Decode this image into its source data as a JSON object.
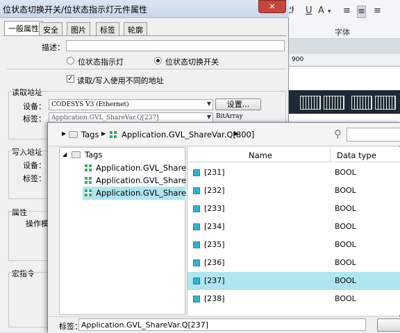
{
  "background": {
    "font_group_label": "字体",
    "ruler_value": "900"
  },
  "prop_dialog": {
    "title": "位状态切换开关/位状态指示灯元件属性",
    "close_label": "✕",
    "tabs": [
      "一般属性",
      "安全",
      "图片",
      "标签",
      "轮廓"
    ],
    "description_label": "描述：",
    "description_value": "",
    "radio_indicator": "位状态指示灯",
    "radio_switch": "位状态切换开关",
    "checkbox_label": "读取/写入使用不同的地址",
    "read_group": "读取地址",
    "read_device_label": "设备：",
    "read_device_value": "CODESYS V3 (Ethernet)",
    "settings_button": "设置...",
    "read_tag_label": "标签：",
    "read_tag_value": "Application.GVL_ShareVar.Q[237]",
    "tag_type": "BitArray",
    "write_group": "写入地址",
    "write_device_label": "设备：",
    "write_tag_label": "标签：",
    "attr_group": "属性",
    "operation_label": "操作模",
    "macro_group": "宏指令"
  },
  "tag_browser": {
    "breadcrumb_root": "Tags",
    "breadcrumb_path": "Application.GVL_ShareVar.Q[800]",
    "search_value": "",
    "tree": {
      "root": "Tags",
      "items": [
        "Application.GVL_Share...",
        "Application.GVL_Share...",
        "Application.GVL_Share..."
      ]
    },
    "columns": {
      "name": "Name",
      "type": "Data type"
    },
    "rows": [
      {
        "name": "[231]",
        "type": "BOOL"
      },
      {
        "name": "[232]",
        "type": "BOOL"
      },
      {
        "name": "[233]",
        "type": "BOOL"
      },
      {
        "name": "[234]",
        "type": "BOOL"
      },
      {
        "name": "[235]",
        "type": "BOOL"
      },
      {
        "name": "[236]",
        "type": "BOOL"
      },
      {
        "name": "[237]",
        "type": "BOOL"
      },
      {
        "name": "[238]",
        "type": "BOOL"
      }
    ],
    "bottom_label": "标签：",
    "bottom_value": "Application.GVL_ShareVar.Q[237]"
  }
}
